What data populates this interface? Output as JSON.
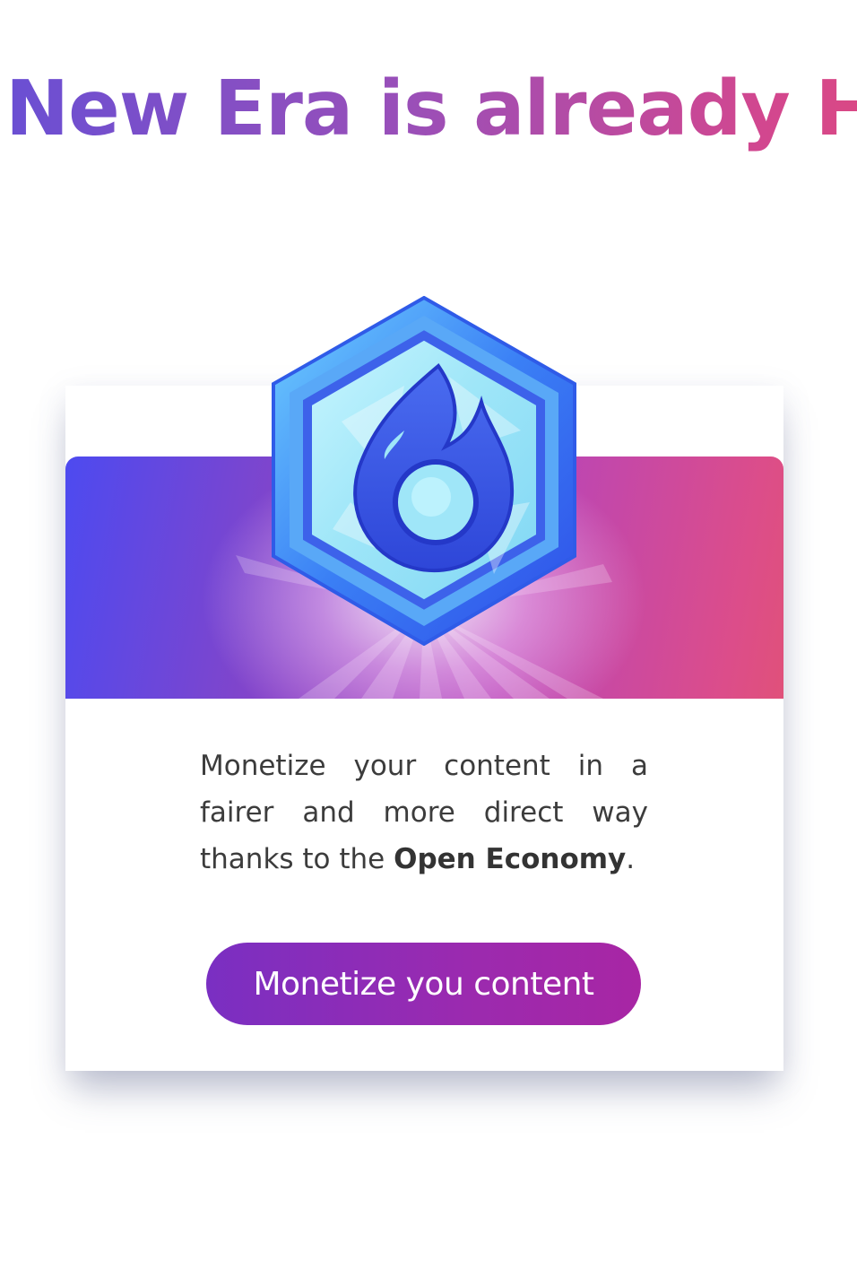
{
  "headline": {
    "text": "New Era is already Here"
  },
  "card": {
    "badge_icon": "flame-hexagon-badge-icon",
    "body_prefix": "Monetize your content in a fairer and more direct way thanks to the ",
    "body_emphasis": "Open Economy",
    "body_suffix": ".",
    "cta_label": "Monetize you content"
  },
  "colors": {
    "headline_start": "#6a4fd3",
    "headline_end": "#e54a75",
    "hero_start": "#4d4af0",
    "hero_end": "#e0517a",
    "cta_start": "#7a2fc2",
    "cta_end": "#a826a4"
  }
}
